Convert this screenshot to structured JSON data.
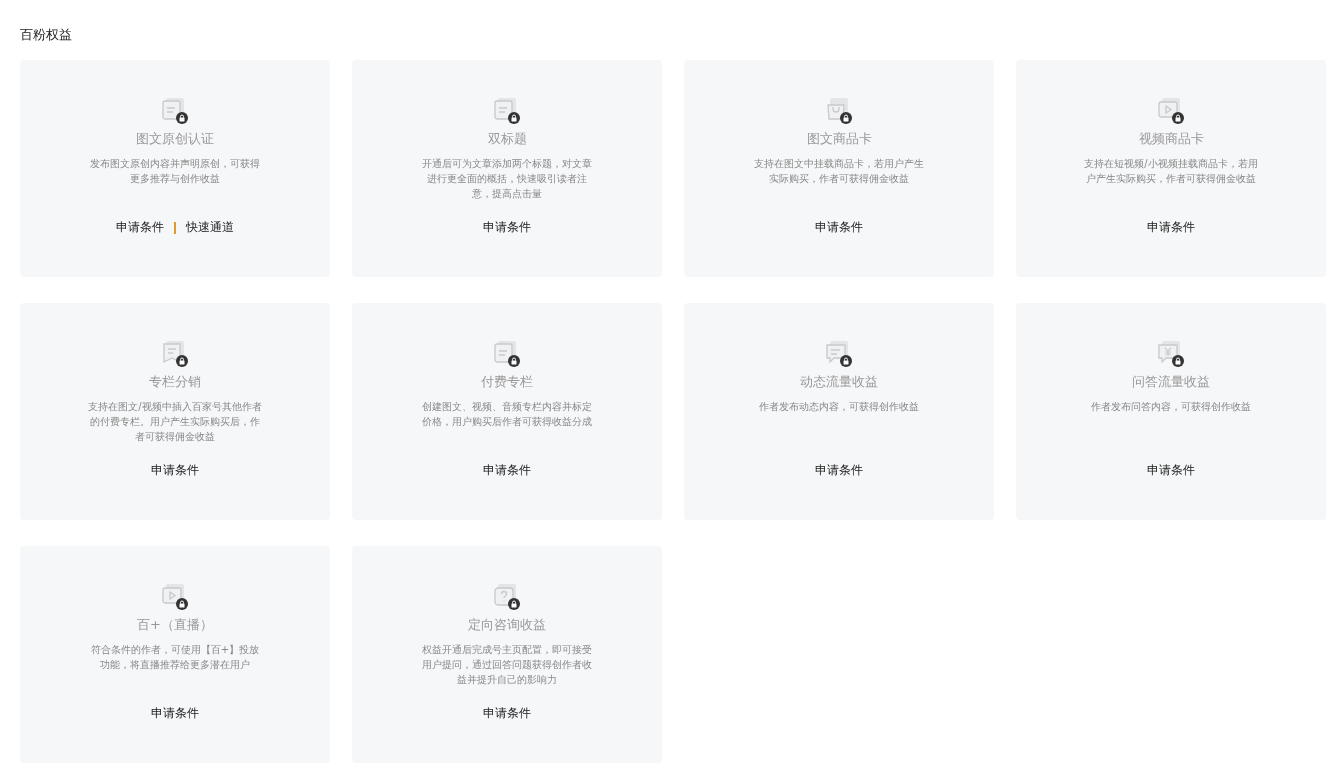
{
  "section_title": "百粉权益",
  "cards": [
    {
      "kind": "doc",
      "title": "图文原创认证",
      "description": "发布图文原创内容并声明原创，可获得更多推荐与创作收益",
      "links": [
        "申请条件",
        "快速通道"
      ]
    },
    {
      "kind": "doc",
      "title": "双标题",
      "description": "开通后可为文章添加两个标题，对文章进行更全面的概括，快速吸引读者注意，提高点击量",
      "links": [
        "申请条件"
      ]
    },
    {
      "kind": "bag",
      "title": "图文商品卡",
      "description": "支持在图文中挂载商品卡，若用户产生实际购买，作者可获得佣金收益",
      "links": [
        "申请条件"
      ]
    },
    {
      "kind": "video",
      "title": "视频商品卡",
      "description": "支持在短视频/小视频挂载商品卡，若用户产生实际购买，作者可获得佣金收益",
      "links": [
        "申请条件"
      ]
    },
    {
      "kind": "bookmark",
      "title": "专栏分销",
      "description": "支持在图文/视频中插入百家号其他作者的付费专栏。用户产生实际购买后，作者可获得佣金收益",
      "links": [
        "申请条件"
      ]
    },
    {
      "kind": "doc",
      "title": "付费专栏",
      "description": "创建图文、视频、音频专栏内容并标定价格，用户购买后作者可获得收益分成",
      "links": [
        "申请条件"
      ]
    },
    {
      "kind": "chat",
      "title": "动态流量收益",
      "description": "作者发布动态内容，可获得创作收益",
      "links": [
        "申请条件"
      ]
    },
    {
      "kind": "chat-yen",
      "title": "问答流量收益",
      "description": "作者发布问答内容，可获得创作收益",
      "links": [
        "申请条件"
      ]
    },
    {
      "kind": "video",
      "title": "百+（直播）",
      "description": "符合条件的作者，可使用【百+】投放功能，将直播推荐给更多潜在用户",
      "links": [
        "申请条件"
      ]
    },
    {
      "kind": "question",
      "title": "定向咨询收益",
      "description": "权益开通后完成号主页配置，即可接受用户提问，通过回答问题获得创作者收益并提升自己的影响力",
      "links": [
        "申请条件"
      ]
    }
  ]
}
